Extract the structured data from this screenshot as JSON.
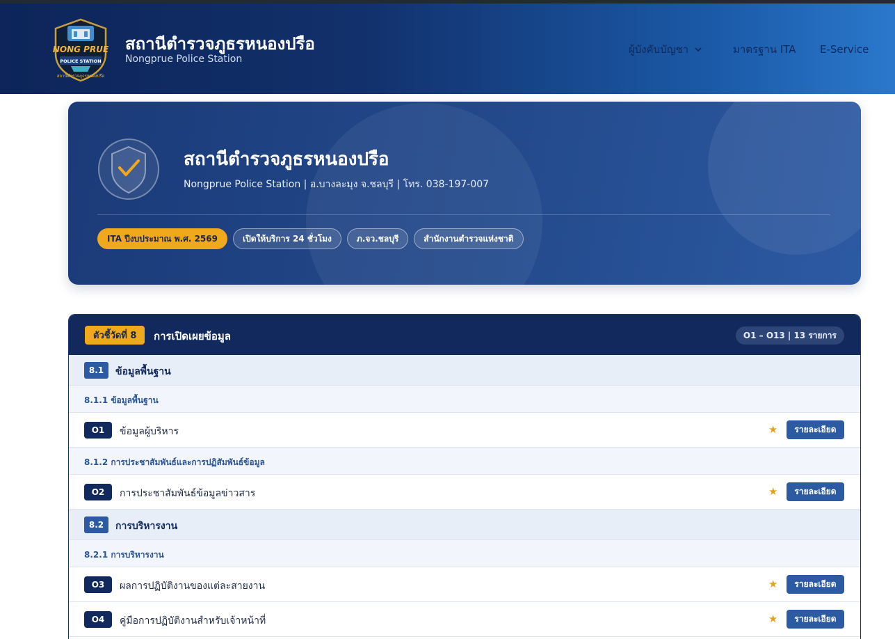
{
  "header": {
    "logo_text_top": "NONG PRUE",
    "logo_text_band": "POLICE STATION",
    "logo_text_arc": "สถานีตำรวจภูธรหนองปรือ",
    "title": "สถานีตำรวจภูธรหนองปรือ",
    "subtitle": "Nongprue Police Station",
    "nav": [
      {
        "label": "ผู้บังคับบัญชา",
        "has_dropdown": true
      },
      {
        "label": "มาตรฐาน ITA"
      },
      {
        "label": "E-Service"
      }
    ]
  },
  "hero": {
    "title": "สถานีตำรวจภูธรหนองปรือ",
    "subtitle": "Nongprue Police Station  |  อ.บางละมุง จ.ชลบุรี  |  โทร. 038-197-007",
    "badges": [
      "ITA ปีงบประมาณ พ.ศ. 2569",
      "เปิดให้บริการ 24 ชั่วโมง",
      "ภ.จว.ชลบุรี",
      "สำนักงานตำรวจแห่งชาติ"
    ]
  },
  "indicator": {
    "badge": "ตัวชี้วัดที่ 8",
    "title": "การเปิดเผยข้อมูล",
    "count": "O1 – O13 | 13 รายการ",
    "sections": [
      {
        "num": "8.1",
        "label": "ข้อมูลพื้นฐาน",
        "subsections": [
          {
            "label": "8.1.1 ข้อมูลพื้นฐาน",
            "items": [
              {
                "code": "O1",
                "label": "ข้อมูลผู้บริหาร"
              }
            ]
          },
          {
            "label": "8.1.2 การประชาสัมพันธ์และการปฏิสัมพันธ์ข้อมูล",
            "items": [
              {
                "code": "O2",
                "label": "การประชาสัมพันธ์ข้อมูลข่าวสาร"
              }
            ]
          }
        ]
      },
      {
        "num": "8.2",
        "label": "การบริหารงาน",
        "subsections": [
          {
            "label": "8.2.1 การบริหารงาน",
            "items": [
              {
                "code": "O3",
                "label": "ผลการปฏิบัติงานของแต่ละสายงาน"
              },
              {
                "code": "O4",
                "label": "คู่มือการปฏิบัติงานสำหรับเจ้าหน้าที่"
              }
            ]
          }
        ]
      }
    ],
    "detail_label": "รายละเอียด",
    "star": "★"
  },
  "colors": {
    "header_dark": "#0d2559",
    "header_light": "#2a78cc",
    "accent_gold": "#f0a91c",
    "primary_blue": "#2c5aa3",
    "navy": "#12295e"
  }
}
